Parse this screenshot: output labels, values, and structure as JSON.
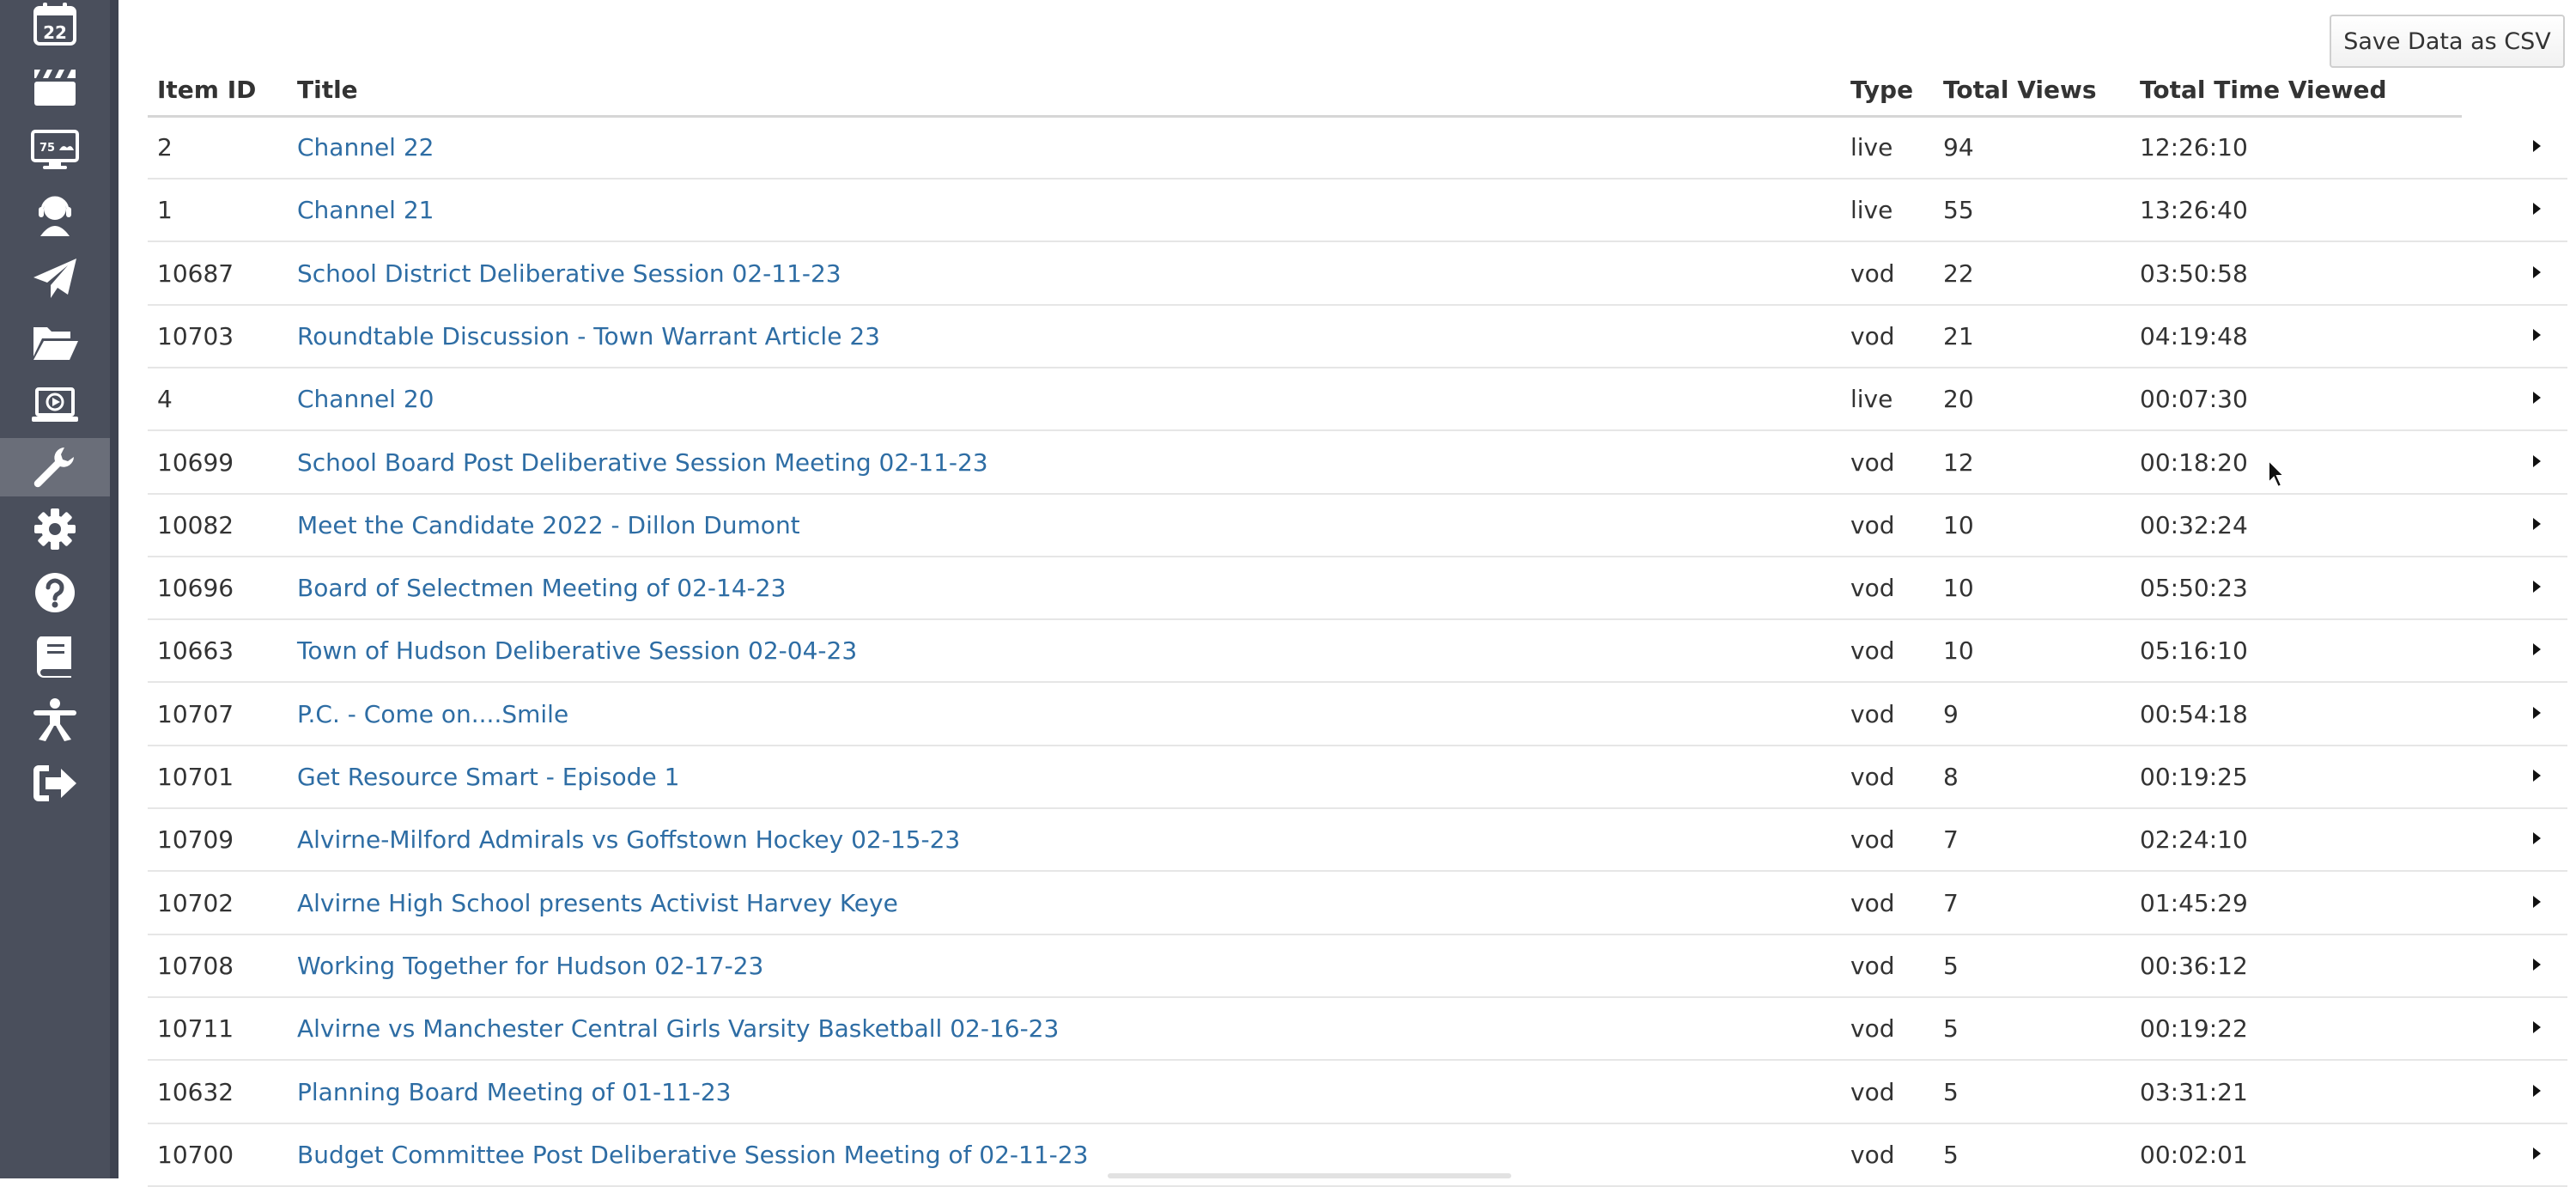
{
  "sidebar": {
    "items": [
      {
        "name": "calendar",
        "icon": "calendar-icon",
        "label": "22"
      },
      {
        "name": "clapperboard",
        "icon": "clapperboard-icon"
      },
      {
        "name": "monitor",
        "icon": "monitor-icon",
        "label": "75"
      },
      {
        "name": "support",
        "icon": "headset-icon"
      },
      {
        "name": "send",
        "icon": "paper-plane-icon"
      },
      {
        "name": "files",
        "icon": "folder-open-icon"
      },
      {
        "name": "video",
        "icon": "laptop-play-icon"
      },
      {
        "name": "tools",
        "icon": "wrench-icon",
        "active": true
      },
      {
        "name": "settings",
        "icon": "gear-icon"
      },
      {
        "name": "help",
        "icon": "question-circle-icon"
      },
      {
        "name": "docs",
        "icon": "book-icon"
      },
      {
        "name": "accessibility",
        "icon": "person-icon"
      },
      {
        "name": "logout",
        "icon": "sign-out-icon"
      }
    ],
    "colors": {
      "background": "#4a4f5c",
      "active": "#6a6e79",
      "icon": "#ffffff"
    }
  },
  "toolbar": {
    "save_csv_label": "Save Data as CSV"
  },
  "table": {
    "columns": {
      "item_id": "Item ID",
      "title": "Title",
      "type": "Type",
      "total_views": "Total Views",
      "total_time": "Total Time Viewed"
    },
    "rows": [
      {
        "id": "2",
        "title": "Channel 22",
        "type": "live",
        "views": "94",
        "time": "12:26:10"
      },
      {
        "id": "1",
        "title": "Channel 21",
        "type": "live",
        "views": "55",
        "time": "13:26:40"
      },
      {
        "id": "10687",
        "title": "School District Deliberative Session 02-11-23",
        "type": "vod",
        "views": "22",
        "time": "03:50:58"
      },
      {
        "id": "10703",
        "title": "Roundtable Discussion - Town Warrant Article 23",
        "type": "vod",
        "views": "21",
        "time": "04:19:48"
      },
      {
        "id": "4",
        "title": "Channel 20",
        "type": "live",
        "views": "20",
        "time": "00:07:30"
      },
      {
        "id": "10699",
        "title": "School Board Post Deliberative Session Meeting 02-11-23",
        "type": "vod",
        "views": "12",
        "time": "00:18:20"
      },
      {
        "id": "10082",
        "title": "Meet the Candidate 2022 - Dillon Dumont",
        "type": "vod",
        "views": "10",
        "time": "00:32:24"
      },
      {
        "id": "10696",
        "title": "Board of Selectmen Meeting of 02-14-23",
        "type": "vod",
        "views": "10",
        "time": "05:50:23"
      },
      {
        "id": "10663",
        "title": "Town of Hudson Deliberative Session 02-04-23",
        "type": "vod",
        "views": "10",
        "time": "05:16:10"
      },
      {
        "id": "10707",
        "title": "P.C. - Come on....Smile",
        "type": "vod",
        "views": "9",
        "time": "00:54:18"
      },
      {
        "id": "10701",
        "title": "Get Resource Smart - Episode 1",
        "type": "vod",
        "views": "8",
        "time": "00:19:25"
      },
      {
        "id": "10709",
        "title": "Alvirne-Milford Admirals vs Goffstown Hockey 02-15-23",
        "type": "vod",
        "views": "7",
        "time": "02:24:10"
      },
      {
        "id": "10702",
        "title": "Alvirne High School presents Activist Harvey Keye",
        "type": "vod",
        "views": "7",
        "time": "01:45:29"
      },
      {
        "id": "10708",
        "title": "Working Together for Hudson 02-17-23",
        "type": "vod",
        "views": "5",
        "time": "00:36:12"
      },
      {
        "id": "10711",
        "title": "Alvirne vs Manchester Central Girls Varsity Basketball 02-16-23",
        "type": "vod",
        "views": "5",
        "time": "00:19:22"
      },
      {
        "id": "10632",
        "title": "Planning Board Meeting of 01-11-23",
        "type": "vod",
        "views": "5",
        "time": "03:31:21"
      },
      {
        "id": "10700",
        "title": "Budget Committee Post Deliberative Session Meeting of 02-11-23",
        "type": "vod",
        "views": "5",
        "time": "00:02:01"
      }
    ],
    "colors": {
      "link": "#2e6da4",
      "text": "#333333",
      "row_border": "#e6e6e6"
    }
  }
}
